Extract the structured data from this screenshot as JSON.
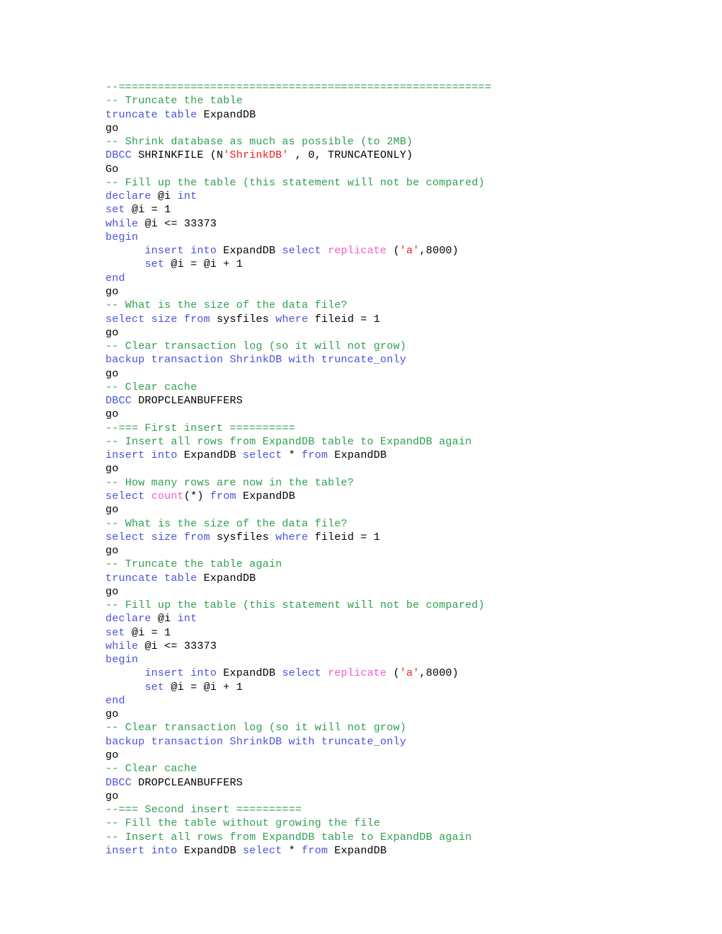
{
  "document": {
    "kind": "sql-script-document",
    "page_background": "#ffffff",
    "colors": {
      "plain": "#000000",
      "keyword": "#4a52db",
      "comment": "#2e9f4e",
      "string": "#ef2020",
      "function": "#f05cd0"
    },
    "lines": [
      {
        "indent": 0,
        "tokens": [
          {
            "t": "--=========================================================",
            "c": "comment"
          }
        ]
      },
      {
        "indent": 0,
        "tokens": [
          {
            "t": "-- Truncate the table",
            "c": "comment"
          }
        ]
      },
      {
        "indent": 0,
        "tokens": [
          {
            "t": "truncate table ",
            "c": "kw"
          },
          {
            "t": "ExpandDB",
            "c": "plain"
          }
        ]
      },
      {
        "indent": 0,
        "tokens": [
          {
            "t": "go",
            "c": "plain"
          }
        ]
      },
      {
        "indent": 0,
        "tokens": [
          {
            "t": "-- Shrink database as much as possible (to 2MB)",
            "c": "comment"
          }
        ]
      },
      {
        "indent": 0,
        "tokens": [
          {
            "t": "DBCC",
            "c": "kw"
          },
          {
            "t": " SHRINKFILE (N",
            "c": "plain"
          },
          {
            "t": "'ShrinkDB'",
            "c": "string"
          },
          {
            "t": " , 0, TRUNCATEONLY)",
            "c": "plain"
          }
        ]
      },
      {
        "indent": 0,
        "tokens": [
          {
            "t": "Go",
            "c": "plain"
          }
        ]
      },
      {
        "indent": 0,
        "tokens": [
          {
            "t": "-- Fill up the table (this statement will not be compared)",
            "c": "comment"
          }
        ]
      },
      {
        "indent": 0,
        "tokens": [
          {
            "t": "declare",
            "c": "kw"
          },
          {
            "t": " @i ",
            "c": "plain"
          },
          {
            "t": "int",
            "c": "kw"
          }
        ]
      },
      {
        "indent": 0,
        "tokens": [
          {
            "t": "set",
            "c": "kw"
          },
          {
            "t": " @i = 1",
            "c": "plain"
          }
        ]
      },
      {
        "indent": 0,
        "tokens": [
          {
            "t": "while",
            "c": "kw"
          },
          {
            "t": " @i <= 33373",
            "c": "plain"
          }
        ]
      },
      {
        "indent": 0,
        "tokens": [
          {
            "t": "begin",
            "c": "kw"
          }
        ]
      },
      {
        "indent": 1,
        "tokens": [
          {
            "t": "insert into",
            "c": "kw"
          },
          {
            "t": " ExpandDB ",
            "c": "plain"
          },
          {
            "t": "select",
            "c": "kw"
          },
          {
            "t": " ",
            "c": "plain"
          },
          {
            "t": "replicate",
            "c": "func"
          },
          {
            "t": " (",
            "c": "plain"
          },
          {
            "t": "'a'",
            "c": "string"
          },
          {
            "t": ",8000)",
            "c": "plain"
          }
        ]
      },
      {
        "indent": 1,
        "tokens": [
          {
            "t": "set",
            "c": "kw"
          },
          {
            "t": " @i = @i + 1",
            "c": "plain"
          }
        ]
      },
      {
        "indent": 0,
        "tokens": [
          {
            "t": "end",
            "c": "kw"
          }
        ]
      },
      {
        "indent": 0,
        "tokens": [
          {
            "t": "go",
            "c": "plain"
          }
        ]
      },
      {
        "indent": 0,
        "tokens": [
          {
            "t": "-- What is the size of the data file?",
            "c": "comment"
          }
        ]
      },
      {
        "indent": 0,
        "tokens": [
          {
            "t": "select size from",
            "c": "kw"
          },
          {
            "t": " sysfiles ",
            "c": "plain"
          },
          {
            "t": "where",
            "c": "kw"
          },
          {
            "t": " fileid = 1",
            "c": "plain"
          }
        ]
      },
      {
        "indent": 0,
        "tokens": [
          {
            "t": "go",
            "c": "plain"
          }
        ]
      },
      {
        "indent": 0,
        "tokens": [
          {
            "t": "-- Clear transaction log (so it will not grow)",
            "c": "comment"
          }
        ]
      },
      {
        "indent": 0,
        "tokens": [
          {
            "t": "backup transaction ShrinkDB with truncate_only",
            "c": "kw"
          }
        ]
      },
      {
        "indent": 0,
        "tokens": [
          {
            "t": "go",
            "c": "plain"
          }
        ]
      },
      {
        "indent": 0,
        "tokens": [
          {
            "t": "-- Clear cache",
            "c": "comment"
          }
        ]
      },
      {
        "indent": 0,
        "tokens": [
          {
            "t": "DBCC",
            "c": "kw"
          },
          {
            "t": " DROPCLEANBUFFERS",
            "c": "plain"
          }
        ]
      },
      {
        "indent": 0,
        "tokens": [
          {
            "t": "go",
            "c": "plain"
          }
        ]
      },
      {
        "indent": 0,
        "tokens": [
          {
            "t": "--=== First insert ==========",
            "c": "comment"
          }
        ]
      },
      {
        "indent": 0,
        "tokens": [
          {
            "t": "-- Insert all rows from ExpandDB table to ExpandDB again",
            "c": "comment"
          }
        ]
      },
      {
        "indent": 0,
        "tokens": [
          {
            "t": "insert into",
            "c": "kw"
          },
          {
            "t": " ExpandDB ",
            "c": "plain"
          },
          {
            "t": "select",
            "c": "kw"
          },
          {
            "t": " * ",
            "c": "plain"
          },
          {
            "t": "from",
            "c": "kw"
          },
          {
            "t": " ExpandDB",
            "c": "plain"
          }
        ]
      },
      {
        "indent": 0,
        "tokens": [
          {
            "t": "go",
            "c": "plain"
          }
        ]
      },
      {
        "indent": 0,
        "tokens": [
          {
            "t": "-- How many rows are now in the table?",
            "c": "comment"
          }
        ]
      },
      {
        "indent": 0,
        "tokens": [
          {
            "t": "select",
            "c": "kw"
          },
          {
            "t": " ",
            "c": "plain"
          },
          {
            "t": "count",
            "c": "func"
          },
          {
            "t": "(*) ",
            "c": "plain"
          },
          {
            "t": "from",
            "c": "kw"
          },
          {
            "t": " ExpandDB",
            "c": "plain"
          }
        ]
      },
      {
        "indent": 0,
        "tokens": [
          {
            "t": "go",
            "c": "plain"
          }
        ]
      },
      {
        "indent": 0,
        "tokens": [
          {
            "t": "-- What is the size of the data file?",
            "c": "comment"
          }
        ]
      },
      {
        "indent": 0,
        "tokens": [
          {
            "t": "select size from",
            "c": "kw"
          },
          {
            "t": " sysfiles ",
            "c": "plain"
          },
          {
            "t": "where",
            "c": "kw"
          },
          {
            "t": " fileid = 1",
            "c": "plain"
          }
        ]
      },
      {
        "indent": 0,
        "tokens": [
          {
            "t": "go",
            "c": "plain"
          }
        ]
      },
      {
        "indent": 0,
        "tokens": [
          {
            "t": "-- Truncate the table again",
            "c": "comment"
          }
        ]
      },
      {
        "indent": 0,
        "tokens": [
          {
            "t": "truncate table ",
            "c": "kw"
          },
          {
            "t": "ExpandDB",
            "c": "plain"
          }
        ]
      },
      {
        "indent": 0,
        "tokens": [
          {
            "t": "go",
            "c": "plain"
          }
        ]
      },
      {
        "indent": 0,
        "tokens": [
          {
            "t": "-- Fill up the table (this statement will not be compared)",
            "c": "comment"
          }
        ]
      },
      {
        "indent": 0,
        "tokens": [
          {
            "t": "declare",
            "c": "kw"
          },
          {
            "t": " @i ",
            "c": "plain"
          },
          {
            "t": "int",
            "c": "kw"
          }
        ]
      },
      {
        "indent": 0,
        "tokens": [
          {
            "t": "set",
            "c": "kw"
          },
          {
            "t": " @i = 1",
            "c": "plain"
          }
        ]
      },
      {
        "indent": 0,
        "tokens": [
          {
            "t": "while",
            "c": "kw"
          },
          {
            "t": " @i <= 33373",
            "c": "plain"
          }
        ]
      },
      {
        "indent": 0,
        "tokens": [
          {
            "t": "begin",
            "c": "kw"
          }
        ]
      },
      {
        "indent": 1,
        "tokens": [
          {
            "t": "insert into",
            "c": "kw"
          },
          {
            "t": " ExpandDB ",
            "c": "plain"
          },
          {
            "t": "select",
            "c": "kw"
          },
          {
            "t": " ",
            "c": "plain"
          },
          {
            "t": "replicate",
            "c": "func"
          },
          {
            "t": " (",
            "c": "plain"
          },
          {
            "t": "'a'",
            "c": "string"
          },
          {
            "t": ",8000)",
            "c": "plain"
          }
        ]
      },
      {
        "indent": 1,
        "tokens": [
          {
            "t": "set",
            "c": "kw"
          },
          {
            "t": " @i = @i + 1",
            "c": "plain"
          }
        ]
      },
      {
        "indent": 0,
        "tokens": [
          {
            "t": "end",
            "c": "kw"
          }
        ]
      },
      {
        "indent": 0,
        "tokens": [
          {
            "t": "go",
            "c": "plain"
          }
        ]
      },
      {
        "indent": 0,
        "tokens": [
          {
            "t": "-- Clear transaction log (so it will not grow)",
            "c": "comment"
          }
        ]
      },
      {
        "indent": 0,
        "tokens": [
          {
            "t": "backup transaction ShrinkDB with truncate_only",
            "c": "kw"
          }
        ]
      },
      {
        "indent": 0,
        "tokens": [
          {
            "t": "go",
            "c": "plain"
          }
        ]
      },
      {
        "indent": 0,
        "tokens": [
          {
            "t": "-- Clear cache",
            "c": "comment"
          }
        ]
      },
      {
        "indent": 0,
        "tokens": [
          {
            "t": "DBCC",
            "c": "kw"
          },
          {
            "t": " DROPCLEANBUFFERS",
            "c": "plain"
          }
        ]
      },
      {
        "indent": 0,
        "tokens": [
          {
            "t": "go",
            "c": "plain"
          }
        ]
      },
      {
        "indent": 0,
        "tokens": [
          {
            "t": "--=== Second insert ==========",
            "c": "comment"
          }
        ]
      },
      {
        "indent": 0,
        "tokens": [
          {
            "t": "-- Fill the table without growing the file",
            "c": "comment"
          }
        ]
      },
      {
        "indent": 0,
        "tokens": [
          {
            "t": "-- Insert all rows from ExpandDB table to ExpandDB again",
            "c": "comment"
          }
        ]
      },
      {
        "indent": 0,
        "tokens": [
          {
            "t": "insert into",
            "c": "kw"
          },
          {
            "t": " ExpandDB ",
            "c": "plain"
          },
          {
            "t": "select",
            "c": "kw"
          },
          {
            "t": " * ",
            "c": "plain"
          },
          {
            "t": "from",
            "c": "kw"
          },
          {
            "t": " ExpandDB",
            "c": "plain"
          }
        ]
      }
    ]
  }
}
